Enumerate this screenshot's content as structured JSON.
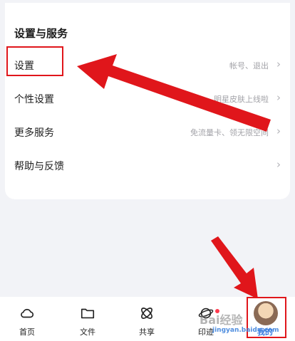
{
  "section": {
    "title": "设置与服务"
  },
  "rows": [
    {
      "label": "设置",
      "hint": "帐号、退出",
      "chevron": "›"
    },
    {
      "label": "个性设置",
      "hint": "明星皮肤上线啦",
      "chevron": "›"
    },
    {
      "label": "更多服务",
      "hint": "免流量卡、领无限空间",
      "chevron": "›"
    },
    {
      "label": "帮助与反馈",
      "hint": "",
      "chevron": "›"
    }
  ],
  "tabbar": {
    "tabs": [
      {
        "label": "首页",
        "icon": "cloud-icon"
      },
      {
        "label": "文件",
        "icon": "folder-icon"
      },
      {
        "label": "共享",
        "icon": "share-atom-icon"
      },
      {
        "label": "印迹",
        "icon": "planet-icon"
      },
      {
        "label": "我的",
        "icon": "avatar-icon"
      }
    ]
  },
  "watermark": {
    "text": "Bai经验",
    "sub": "jingyan.baidu.com"
  },
  "colors": {
    "annotation_red": "#e0161b",
    "badge_dot": "#ff3b4e",
    "background": "#f2f3f7"
  }
}
